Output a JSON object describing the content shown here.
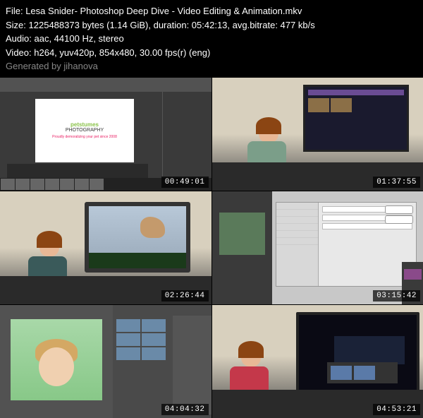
{
  "info": {
    "file_label": "File:",
    "file_value": "Lesa Snider- Photoshop Deep Dive - Video Editing & Animation.mkv",
    "size_label": "Size:",
    "size_value": "1225488373 bytes (1.14 GiB), duration: 05:42:13, avg.bitrate: 477 kb/s",
    "audio_label": "Audio:",
    "audio_value": "aac, 44100 Hz, stereo",
    "video_label": "Video:",
    "video_value": "h264, yuv420p, 854x480, 30.00 fps(r) (eng)",
    "generated": "Generated by jihanova"
  },
  "thumbnails": [
    {
      "timestamp": "00:49:01"
    },
    {
      "timestamp": "01:37:55"
    },
    {
      "timestamp": "02:26:44"
    },
    {
      "timestamp": "03:15:42"
    },
    {
      "timestamp": "04:04:32"
    },
    {
      "timestamp": "04:53:21"
    }
  ],
  "t1_content": {
    "logo1": "petstumes",
    "logo2": "PHOTOGRAPHY",
    "tagline": "Proudly demoralizing your pet since 2008"
  }
}
